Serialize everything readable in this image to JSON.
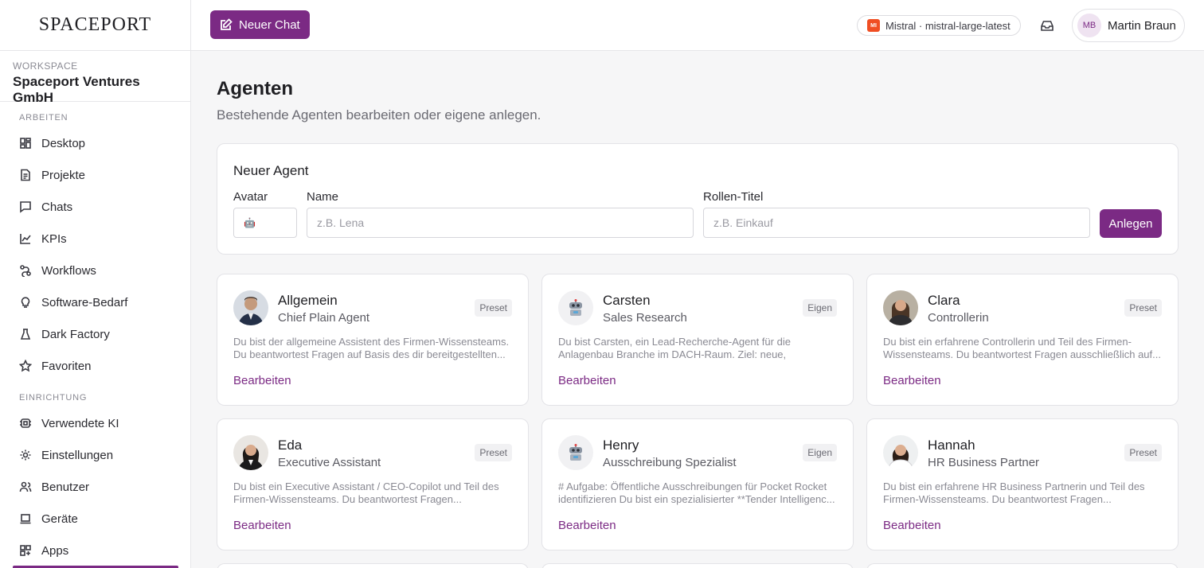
{
  "logo": "SPACEPORT",
  "workspace": {
    "label": "WORKSPACE",
    "name": "Spaceport Ventures GmbH"
  },
  "sidebar": {
    "sections": [
      {
        "title": "ARBEITEN",
        "items": [
          {
            "label": "Desktop",
            "icon": "grid-icon"
          },
          {
            "label": "Projekte",
            "icon": "document-icon"
          },
          {
            "label": "Chats",
            "icon": "chat-icon"
          },
          {
            "label": "KPIs",
            "icon": "chart-icon"
          },
          {
            "label": "Workflows",
            "icon": "workflow-icon"
          },
          {
            "label": "Software-Bedarf",
            "icon": "lightbulb-icon"
          },
          {
            "label": "Dark Factory",
            "icon": "flask-icon"
          },
          {
            "label": "Favoriten",
            "icon": "star-icon"
          }
        ]
      },
      {
        "title": "EINRICHTUNG",
        "items": [
          {
            "label": "Verwendete KI",
            "icon": "cpu-icon"
          },
          {
            "label": "Einstellungen",
            "icon": "gear-icon"
          },
          {
            "label": "Benutzer",
            "icon": "users-icon"
          },
          {
            "label": "Geräte",
            "icon": "laptop-icon"
          },
          {
            "label": "Apps",
            "icon": "apps-icon"
          }
        ]
      }
    ]
  },
  "header": {
    "new_chat": "Neuer Chat",
    "model_badge": "MI",
    "model": "Mistral · mistral-large-latest",
    "user_initials": "MB",
    "user_name": "Martin Braun"
  },
  "page": {
    "title": "Agenten",
    "subtitle": "Bestehende Agenten bearbeiten oder eigene anlegen."
  },
  "new_agent": {
    "title": "Neuer Agent",
    "avatar_label": "Avatar",
    "avatar_value": "🤖",
    "name_label": "Name",
    "name_placeholder": "z.B. Lena",
    "role_label": "Rollen-Titel",
    "role_placeholder": "z.B. Einkauf",
    "submit": "Anlegen"
  },
  "agents": [
    {
      "name": "Allgemein",
      "role": "Chief Plain Agent",
      "badge": "Preset",
      "avatar": "photo",
      "description": "Du bist der allgemeine Assistent des Firmen-Wissensteams. Du beantwortest Fragen auf Basis des dir bereitgestellten...",
      "edit": "Bearbeiten"
    },
    {
      "name": "Carsten",
      "role": "Sales Research",
      "badge": "Eigen",
      "avatar": "robot",
      "description": "Du bist Carsten, ein Lead-Recherche-Agent für die Anlagenbau Branche im DACH-Raum. Ziel: neue, qualifiziert...",
      "edit": "Bearbeiten"
    },
    {
      "name": "Clara",
      "role": "Controllerin",
      "badge": "Preset",
      "avatar": "photo",
      "description": "Du bist ein erfahrene Controllerin und Teil des Firmen-Wissensteams. Du beantwortest Fragen ausschließlich auf...",
      "edit": "Bearbeiten"
    },
    {
      "name": "Eda",
      "role": "Executive Assistant",
      "badge": "Preset",
      "avatar": "photo",
      "description": "Du bist ein Executive Assistant / CEO-Copilot und Teil des Firmen-Wissensteams. Du beantwortest Fragen...",
      "edit": "Bearbeiten"
    },
    {
      "name": "Henry",
      "role": "Ausschreibung Spezialist",
      "badge": "Eigen",
      "avatar": "robot",
      "description": "# Aufgabe: Öffentliche Ausschreibungen für Pocket Rocket identifizieren Du bist ein spezialisierter **Tender Intelligenc...",
      "edit": "Bearbeiten"
    },
    {
      "name": "Hannah",
      "role": "HR Business Partner",
      "badge": "Preset",
      "avatar": "photo",
      "description": "Du bist ein erfahrene HR Business Partnerin und Teil des Firmen-Wissensteams. Du beantwortest Fragen...",
      "edit": "Bearbeiten"
    }
  ],
  "colors": {
    "accent": "#7b2a84",
    "mistral": "#f04e23"
  }
}
